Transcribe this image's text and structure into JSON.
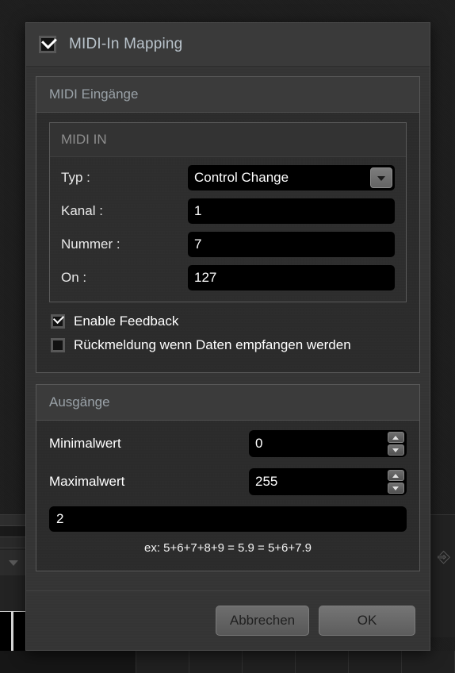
{
  "dialog": {
    "title": "MIDI-In Mapping",
    "title_checkbox_checked": true,
    "sections": {
      "inputs": {
        "header": "MIDI Eingänge",
        "midi_in": {
          "header": "MIDI IN",
          "fields": [
            {
              "label": "Typ :",
              "value": "Control Change",
              "type": "combobox"
            },
            {
              "label": "Kanal :",
              "value": "1",
              "type": "text"
            },
            {
              "label": "Nummer :",
              "value": "7",
              "type": "text"
            },
            {
              "label": "On :",
              "value": "127",
              "type": "text"
            }
          ]
        },
        "checkboxes": [
          {
            "label": "Enable Feedback",
            "checked": true
          },
          {
            "label": "Rückmeldung wenn Daten empfangen werden",
            "checked": false
          }
        ]
      },
      "outputs": {
        "header": "Ausgänge",
        "spinners": [
          {
            "label": "Minimalwert",
            "value": "0"
          },
          {
            "label": "Maximalwert",
            "value": "255"
          }
        ],
        "expression_value": "2",
        "hint": "ex: 5+6+7+8+9 = 5.9 = 5+6+7.9"
      }
    },
    "footer": {
      "cancel_label": "Abbrechen",
      "ok_label": "OK"
    }
  },
  "icons": {
    "combo_arrow": "chevron-down-icon",
    "spin_up": "spinner-up-icon",
    "spin_down": "spinner-down-icon",
    "background_tool": "background-tool-icon"
  },
  "colors": {
    "dialog_bg": "#343434",
    "panel_bg": "#2b2b2b",
    "header_bg": "#3b3b3b",
    "field_bg": "#000000",
    "title_text": "#b9c3cb",
    "header_text": "#9aa2a8",
    "body_text": "#ffffff"
  }
}
